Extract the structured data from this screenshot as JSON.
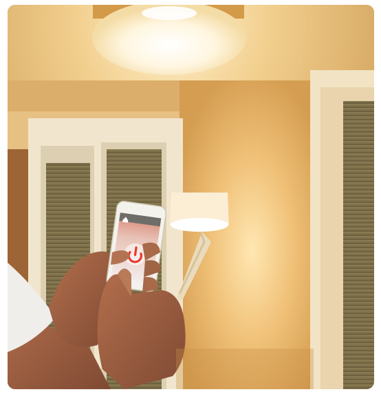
{
  "photo": {
    "scene": "smart-home-lighting-control",
    "icons": [
      "home-icon",
      "power-icon"
    ],
    "colors": {
      "warm_light": "#fff4d8",
      "wall": "#e2ad62",
      "power_button": "#e63a2e"
    }
  }
}
